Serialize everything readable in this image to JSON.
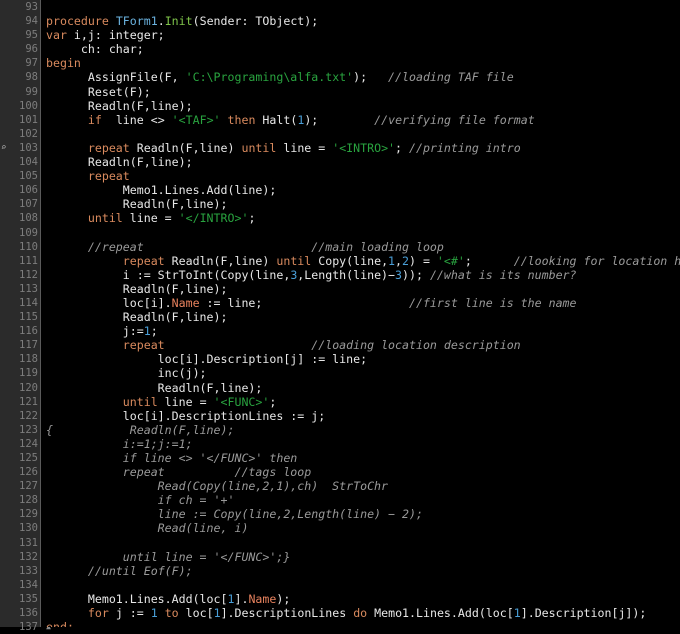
{
  "editor": {
    "language": "Pascal",
    "theme": "dark",
    "colors": {
      "background": "#000000",
      "gutter_background": "#2b2b2b",
      "gutter_text": "#7d7d7d",
      "plain_text": "#e8e8e8",
      "keyword": "#d98a5e",
      "type": "#6bb3e0",
      "procedure_name": "#7fc44a",
      "number": "#4a9fd8",
      "string": "#29a33f",
      "comment": "#9a9a9a",
      "field": "#e8825e"
    },
    "first_line_number": 93,
    "last_line_number": 137
  },
  "gutter": {
    "line_numbers": [
      "93",
      "94",
      "95",
      "96",
      "97",
      "98",
      "99",
      "100",
      "101",
      "102",
      "103",
      "104",
      "105",
      "106",
      "107",
      "108",
      "109",
      "110",
      "111",
      "112",
      "113",
      "114",
      "115",
      "116",
      "117",
      "118",
      "119",
      "120",
      "121",
      "122",
      "123",
      "124",
      "125",
      "126",
      "127",
      "128",
      "129",
      "130",
      "131",
      "132",
      "133",
      "134",
      "135",
      "136",
      "137"
    ],
    "markers": {
      "fold_open_line": "94",
      "fold_open_glyph": "▼",
      "fold_close_line": "137",
      "fold_close_glyph": "▲",
      "search_marker_line": "103",
      "search_marker_glyph": "⌕"
    }
  },
  "lines": [
    {
      "n": "93",
      "tokens": []
    },
    {
      "n": "94",
      "tokens": [
        {
          "t": "procedure ",
          "c": "kw"
        },
        {
          "t": "TForm1",
          "c": "typ"
        },
        {
          "t": ".",
          "c": "pl"
        },
        {
          "t": "Init",
          "c": "proc"
        },
        {
          "t": "(Sender: TObject);",
          "c": "pl"
        }
      ]
    },
    {
      "n": "95",
      "tokens": [
        {
          "t": "var ",
          "c": "kw"
        },
        {
          "t": "i,j: integer;",
          "c": "pl"
        }
      ]
    },
    {
      "n": "96",
      "tokens": [
        {
          "t": "     ch: char;",
          "c": "pl"
        }
      ]
    },
    {
      "n": "97",
      "tokens": [
        {
          "t": "begin",
          "c": "kw"
        }
      ]
    },
    {
      "n": "98",
      "tokens": [
        {
          "t": "      AssignFile(F, ",
          "c": "pl"
        },
        {
          "t": "'C:\\Programing\\alfa.txt'",
          "c": "str"
        },
        {
          "t": ");   ",
          "c": "pl"
        },
        {
          "t": "//loading TAF file",
          "c": "cmt"
        }
      ]
    },
    {
      "n": "99",
      "tokens": [
        {
          "t": "      Reset(F);",
          "c": "pl"
        }
      ]
    },
    {
      "n": "100",
      "tokens": [
        {
          "t": "      Readln(F,line);",
          "c": "pl"
        }
      ]
    },
    {
      "n": "101",
      "tokens": [
        {
          "t": "      ",
          "c": "pl"
        },
        {
          "t": "if",
          "c": "kw"
        },
        {
          "t": "  line <> ",
          "c": "pl"
        },
        {
          "t": "'<TAF>'",
          "c": "str"
        },
        {
          "t": " ",
          "c": "pl"
        },
        {
          "t": "then",
          "c": "kw"
        },
        {
          "t": " Halt(",
          "c": "pl"
        },
        {
          "t": "1",
          "c": "num"
        },
        {
          "t": ");        ",
          "c": "pl"
        },
        {
          "t": "//verifying file format",
          "c": "cmt"
        }
      ]
    },
    {
      "n": "102",
      "tokens": []
    },
    {
      "n": "103",
      "tokens": [
        {
          "t": "      ",
          "c": "pl"
        },
        {
          "t": "repeat",
          "c": "kw"
        },
        {
          "t": " Readln(F,line) ",
          "c": "pl"
        },
        {
          "t": "until",
          "c": "kw"
        },
        {
          "t": " line = ",
          "c": "pl"
        },
        {
          "t": "'<INTRO>'",
          "c": "str"
        },
        {
          "t": "; ",
          "c": "pl"
        },
        {
          "t": "//printing intro",
          "c": "cmt"
        }
      ]
    },
    {
      "n": "104",
      "tokens": [
        {
          "t": "      Readln(F,line);",
          "c": "pl"
        }
      ]
    },
    {
      "n": "105",
      "tokens": [
        {
          "t": "      ",
          "c": "pl"
        },
        {
          "t": "repeat",
          "c": "kw"
        }
      ]
    },
    {
      "n": "106",
      "tokens": [
        {
          "t": "           Memo1.Lines.Add(line);",
          "c": "pl"
        }
      ]
    },
    {
      "n": "107",
      "tokens": [
        {
          "t": "           Readln(F,line);",
          "c": "pl"
        }
      ]
    },
    {
      "n": "108",
      "tokens": [
        {
          "t": "      ",
          "c": "pl"
        },
        {
          "t": "until",
          "c": "kw"
        },
        {
          "t": " line = ",
          "c": "pl"
        },
        {
          "t": "'</INTRO>'",
          "c": "str"
        },
        {
          "t": ";",
          "c": "pl"
        }
      ]
    },
    {
      "n": "109",
      "tokens": []
    },
    {
      "n": "110",
      "tokens": [
        {
          "t": "      ",
          "c": "pl"
        },
        {
          "t": "//repeat",
          "c": "cmt"
        },
        {
          "t": "                        ",
          "c": "pl"
        },
        {
          "t": "//main loading loop",
          "c": "cmt"
        }
      ]
    },
    {
      "n": "111",
      "tokens": [
        {
          "t": "           ",
          "c": "pl"
        },
        {
          "t": "repeat",
          "c": "kw"
        },
        {
          "t": " Readln(F,line) ",
          "c": "pl"
        },
        {
          "t": "until",
          "c": "kw"
        },
        {
          "t": " Copy(line,",
          "c": "pl"
        },
        {
          "t": "1",
          "c": "num"
        },
        {
          "t": ",",
          "c": "pl"
        },
        {
          "t": "2",
          "c": "num"
        },
        {
          "t": ") = ",
          "c": "pl"
        },
        {
          "t": "'<#'",
          "c": "str"
        },
        {
          "t": ";      ",
          "c": "pl"
        },
        {
          "t": "//looking for location head",
          "c": "cmt"
        }
      ]
    },
    {
      "n": "112",
      "tokens": [
        {
          "t": "           i := StrToInt(Copy(line,",
          "c": "pl"
        },
        {
          "t": "3",
          "c": "num"
        },
        {
          "t": ",Length(line)−",
          "c": "pl"
        },
        {
          "t": "3",
          "c": "num"
        },
        {
          "t": ")); ",
          "c": "pl"
        },
        {
          "t": "//what is its number?",
          "c": "cmt"
        }
      ]
    },
    {
      "n": "113",
      "tokens": [
        {
          "t": "           Readln(F,line);",
          "c": "pl"
        }
      ]
    },
    {
      "n": "114",
      "tokens": [
        {
          "t": "           loc[i].",
          "c": "pl"
        },
        {
          "t": "Name",
          "c": "fld"
        },
        {
          "t": " := line;",
          "c": "pl"
        },
        {
          "t": "                     ",
          "c": "pl"
        },
        {
          "t": "//first line is the name",
          "c": "cmt"
        }
      ]
    },
    {
      "n": "115",
      "tokens": [
        {
          "t": "           Readln(F,line);",
          "c": "pl"
        }
      ]
    },
    {
      "n": "116",
      "tokens": [
        {
          "t": "           j:=",
          "c": "pl"
        },
        {
          "t": "1",
          "c": "num"
        },
        {
          "t": ";",
          "c": "pl"
        }
      ]
    },
    {
      "n": "117",
      "tokens": [
        {
          "t": "           ",
          "c": "pl"
        },
        {
          "t": "repeat",
          "c": "kw"
        },
        {
          "t": "                     ",
          "c": "pl"
        },
        {
          "t": "//loading location description",
          "c": "cmt"
        }
      ]
    },
    {
      "n": "118",
      "tokens": [
        {
          "t": "                loc[i].Description[j] := line;",
          "c": "pl"
        }
      ]
    },
    {
      "n": "119",
      "tokens": [
        {
          "t": "                inc(j);",
          "c": "pl"
        }
      ]
    },
    {
      "n": "120",
      "tokens": [
        {
          "t": "                Readln(F,line);",
          "c": "pl"
        }
      ]
    },
    {
      "n": "121",
      "tokens": [
        {
          "t": "           ",
          "c": "pl"
        },
        {
          "t": "until",
          "c": "kw"
        },
        {
          "t": " line = ",
          "c": "pl"
        },
        {
          "t": "'<FUNC>'",
          "c": "str"
        },
        {
          "t": ";",
          "c": "pl"
        }
      ]
    },
    {
      "n": "122",
      "tokens": [
        {
          "t": "           loc[i].DescriptionLines := j;",
          "c": "pl"
        }
      ]
    },
    {
      "n": "123",
      "tokens": [
        {
          "t": "{",
          "c": "cmt"
        },
        {
          "t": "           Readln(F,line);",
          "c": "cmt"
        }
      ],
      "gutter_brace": true
    },
    {
      "n": "124",
      "tokens": [
        {
          "t": "           i:=1;j:=1;",
          "c": "cmt"
        }
      ]
    },
    {
      "n": "125",
      "tokens": [
        {
          "t": "           if line <> '</FUNC>' then",
          "c": "cmt"
        }
      ]
    },
    {
      "n": "126",
      "tokens": [
        {
          "t": "           repeat          //tags loop",
          "c": "cmt"
        }
      ]
    },
    {
      "n": "127",
      "tokens": [
        {
          "t": "                Read(Copy(line,2,1),ch)  StrToChr",
          "c": "cmt"
        }
      ]
    },
    {
      "n": "128",
      "tokens": [
        {
          "t": "                if ch = '+'",
          "c": "cmt"
        }
      ]
    },
    {
      "n": "129",
      "tokens": [
        {
          "t": "                line := Copy(line,2,Length(line) − 2);",
          "c": "cmt"
        }
      ]
    },
    {
      "n": "130",
      "tokens": [
        {
          "t": "                Read(line, i)",
          "c": "cmt"
        }
      ]
    },
    {
      "n": "131",
      "tokens": []
    },
    {
      "n": "132",
      "tokens": [
        {
          "t": "           until line = '</FUNC>';}",
          "c": "cmt"
        }
      ]
    },
    {
      "n": "133",
      "tokens": [
        {
          "t": "      ",
          "c": "pl"
        },
        {
          "t": "//until Eof(F);",
          "c": "cmt"
        }
      ]
    },
    {
      "n": "134",
      "tokens": []
    },
    {
      "n": "135",
      "tokens": [
        {
          "t": "      Memo1.Lines.Add(loc[",
          "c": "pl"
        },
        {
          "t": "1",
          "c": "num"
        },
        {
          "t": "].",
          "c": "pl"
        },
        {
          "t": "Name",
          "c": "fld"
        },
        {
          "t": ");",
          "c": "pl"
        }
      ]
    },
    {
      "n": "136",
      "tokens": [
        {
          "t": "      ",
          "c": "pl"
        },
        {
          "t": "for",
          "c": "kw"
        },
        {
          "t": " j := ",
          "c": "pl"
        },
        {
          "t": "1",
          "c": "num"
        },
        {
          "t": " ",
          "c": "pl"
        },
        {
          "t": "to",
          "c": "kw"
        },
        {
          "t": " loc[",
          "c": "pl"
        },
        {
          "t": "1",
          "c": "num"
        },
        {
          "t": "].DescriptionLines ",
          "c": "pl"
        },
        {
          "t": "do",
          "c": "kw"
        },
        {
          "t": " Memo1.Lines.Add(loc[",
          "c": "pl"
        },
        {
          "t": "1",
          "c": "num"
        },
        {
          "t": "].Description[j]);",
          "c": "pl"
        }
      ]
    },
    {
      "n": "137",
      "tokens": [
        {
          "t": "end;",
          "c": "kw"
        }
      ]
    }
  ]
}
